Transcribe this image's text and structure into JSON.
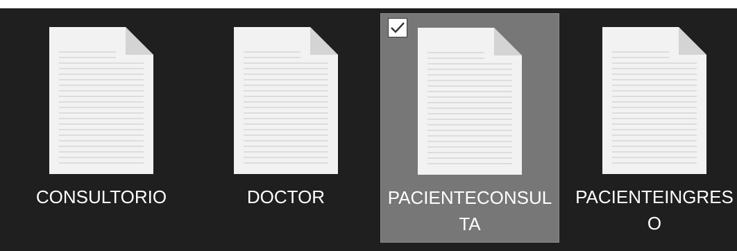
{
  "files": [
    {
      "name": "CONSULTORIO",
      "selected": false,
      "icon": "text-document-icon"
    },
    {
      "name": "DOCTOR",
      "selected": false,
      "icon": "text-document-icon"
    },
    {
      "name": "PACIENTECONSULTA",
      "selected": true,
      "icon": "text-document-icon"
    },
    {
      "name": "PACIENTEINGRESO",
      "selected": false,
      "icon": "text-document-icon"
    }
  ],
  "colors": {
    "background": "#1f1f1f",
    "selection": "#777777",
    "text": "#ffffff"
  }
}
